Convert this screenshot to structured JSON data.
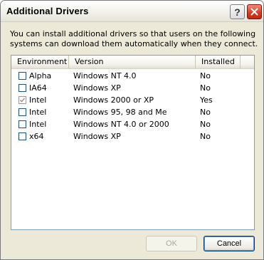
{
  "window": {
    "title": "Additional Drivers",
    "help_glyph": "?"
  },
  "description": "You can install additional drivers so that users on the following systems can download them automatically when they connect.",
  "table": {
    "columns": [
      "Environment",
      "Version",
      "Installed"
    ],
    "rows": [
      {
        "environment": "Alpha",
        "version": "Windows NT 4.0",
        "installed": "No",
        "checked": false
      },
      {
        "environment": "IA64",
        "version": "Windows XP",
        "installed": "No",
        "checked": false
      },
      {
        "environment": "Intel",
        "version": "Windows 2000 or XP",
        "installed": "Yes",
        "checked": true
      },
      {
        "environment": "Intel",
        "version": "Windows 95, 98 and Me",
        "installed": "No",
        "checked": false
      },
      {
        "environment": "Intel",
        "version": "Windows NT 4.0 or 2000",
        "installed": "No",
        "checked": false
      },
      {
        "environment": "x64",
        "version": "Windows XP",
        "installed": "No",
        "checked": false
      }
    ]
  },
  "buttons": {
    "ok": "OK",
    "cancel": "Cancel"
  }
}
